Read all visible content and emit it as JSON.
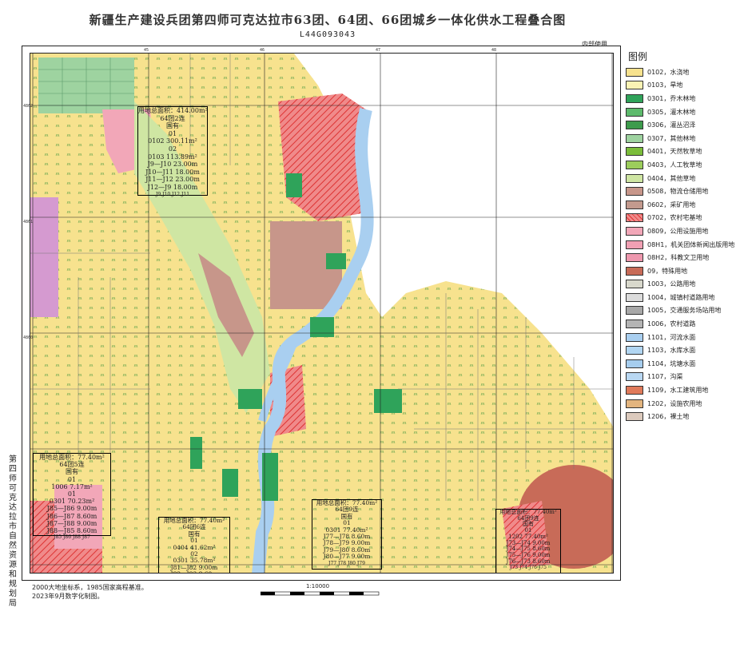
{
  "title": "新疆生产建设兵团第四师可克达拉市63团、64团、66团城乡一体化供水工程叠合图",
  "sheet_code": "L44G093043",
  "secret_label": "内部使用",
  "legend_title": "图例",
  "legend": [
    {
      "label": "0102，水浇地",
      "color": "#f7e28e",
      "pattern": "none"
    },
    {
      "label": "0103，旱地",
      "color": "#fbf3b4",
      "pattern": "none"
    },
    {
      "label": "0301，乔木林地",
      "color": "#2fa35a",
      "pattern": "none"
    },
    {
      "label": "0305，灌木林地",
      "color": "#5dba6c",
      "pattern": "none"
    },
    {
      "label": "0306，灌丛沼泽",
      "color": "#3d9b4c",
      "pattern": "none"
    },
    {
      "label": "0307，其他林地",
      "color": "#9ed3a0",
      "pattern": "none"
    },
    {
      "label": "0401，天然牧草地",
      "color": "#7bbd3a",
      "pattern": "none"
    },
    {
      "label": "0403，人工牧草地",
      "color": "#9ccd5c",
      "pattern": "none"
    },
    {
      "label": "0404，其他草地",
      "color": "#cfe6a3",
      "pattern": "none"
    },
    {
      "label": "0508，物流仓储用地",
      "color": "#c7968a",
      "pattern": "none"
    },
    {
      "label": "0602，采矿用地",
      "color": "#c39a8e",
      "pattern": "none"
    },
    {
      "label": "0702，农村宅基地",
      "color": "#f08a8a",
      "pattern": "hatch"
    },
    {
      "label": "0809，公用设施用地",
      "color": "#f2a7b8",
      "pattern": "none"
    },
    {
      "label": "08H1，机关团体新闻出版用地",
      "color": "#f0a0b3",
      "pattern": "none"
    },
    {
      "label": "08H2，科教文卫用地",
      "color": "#ee98ae",
      "pattern": "none"
    },
    {
      "label": "09，特殊用地",
      "color": "#c86b58",
      "pattern": "none"
    },
    {
      "label": "1003，公路用地",
      "color": "#d8d8cc",
      "pattern": "none"
    },
    {
      "label": "1004，城镇村道路用地",
      "color": "#dcdcdc",
      "pattern": "none"
    },
    {
      "label": "1005，交通服务场站用地",
      "color": "#a8a8a8",
      "pattern": "none"
    },
    {
      "label": "1006，农村道路",
      "color": "#b4b4b4",
      "pattern": "none"
    },
    {
      "label": "1101，河流水面",
      "color": "#a9cff0",
      "pattern": "none"
    },
    {
      "label": "1103，水库水面",
      "color": "#b2d6f2",
      "pattern": "none"
    },
    {
      "label": "1104，坑塘水面",
      "color": "#a6cdee",
      "pattern": "none"
    },
    {
      "label": "1107，沟渠",
      "color": "#b9d8f3",
      "pattern": "none"
    },
    {
      "label": "1109，水工建筑用地",
      "color": "#e07a5a",
      "pattern": "none"
    },
    {
      "label": "1202，设施农用地",
      "color": "#e3b57f",
      "pattern": "none"
    },
    {
      "label": "1206，裸土地",
      "color": "#dccabd",
      "pattern": "none"
    }
  ],
  "side_org": "第四师可克达拉市自然资源和规划局",
  "footnotes": [
    "2000大地坐标系，1985国家高程基准。",
    "2023年9月数字化制图。"
  ],
  "scale": "1:10000",
  "annotations": [
    {
      "lines": [
        "用地总面积：414.00m²",
        "64团2连",
        "国有",
        "01",
        "0102   300.11m²",
        "02",
        "0103  113.89m²",
        "J9—J10  23.00m",
        "J10—J11  18.00m",
        "J11—J12  23.00m",
        "J12—J9  18.00m"
      ],
      "points": [
        "J9",
        "J10",
        "J12",
        "J11"
      ]
    },
    {
      "lines": [
        "用地总面积：77.40m²",
        "64团5连",
        "国有",
        "01",
        "1006   7.17m²",
        "01",
        "0301   70.23m²",
        "J85—J86  9.00m",
        "J86—J87  8.60m",
        "J87—J88  9.00m",
        "J88—J85  8.60m"
      ],
      "points": [
        "J85",
        "J86",
        "J88",
        "J87"
      ]
    },
    {
      "lines": [
        "用地总面积：77.40m²",
        "64团6连",
        "国有",
        "01",
        "0404  41.62m²",
        "02",
        "0301  35.78m²",
        "J81—J82  9.00m",
        "J82—J83  8.60m",
        "J83—J84  9.00m",
        "J84—J81  8.60m"
      ],
      "points": [
        "J81",
        "J82",
        "J84",
        "J83"
      ]
    },
    {
      "lines": [
        "用地总面积：77.40m²",
        "64团9连",
        "国有",
        "01",
        "0301   77.40m²",
        "J77—J78  8.60m",
        "J78—J79  9.00m",
        "J79—J80  8.60m",
        "J80—J77  9.00m"
      ],
      "points": [
        "J77",
        "J78",
        "J80",
        "J79"
      ]
    },
    {
      "lines": [
        "用地总面积：77.40m²",
        "64团9连",
        "国有",
        "01",
        "1202   77.40m²",
        "J73—J74  9.00m",
        "J74—J75  8.60m",
        "J75—J76  9.00m",
        "J76—J73  8.60m"
      ],
      "points": [
        "J73",
        "J74",
        "J76",
        "J75"
      ]
    }
  ],
  "coords": {
    "top": [
      "45",
      "46",
      "47",
      "48"
    ],
    "left": [
      "4862",
      "4861",
      "4860"
    ]
  }
}
